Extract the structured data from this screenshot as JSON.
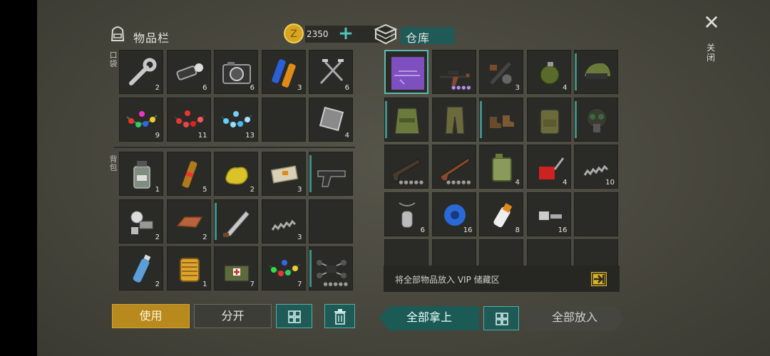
{
  "inventory": {
    "title": "物品栏",
    "coins": "2350",
    "pocket_label": "口袋",
    "backpack_label": "背包",
    "pocket_slots": [
      {
        "icon": "wrench-icon",
        "count": "2"
      },
      {
        "icon": "flashlight-icon",
        "count": "6"
      },
      {
        "icon": "camera-icon",
        "count": "6"
      },
      {
        "icon": "battery-icon",
        "count": "3"
      },
      {
        "icon": "nails-icon",
        "count": "6"
      },
      {
        "icon": "christmas-lights-multicolor-icon",
        "count": "9"
      },
      {
        "icon": "christmas-lights-red-icon",
        "count": "11"
      },
      {
        "icon": "christmas-lights-blue-icon",
        "count": "13"
      },
      {
        "icon": "empty",
        "count": ""
      },
      {
        "icon": "metal-plate-icon",
        "count": "4"
      }
    ],
    "backpack_slots": [
      {
        "icon": "jar-icon",
        "count": "1"
      },
      {
        "icon": "ampoule-icon",
        "count": "5"
      },
      {
        "icon": "gold-nugget-icon",
        "count": "2"
      },
      {
        "icon": "bandage-box-icon",
        "count": "3"
      },
      {
        "icon": "pistol-icon",
        "count": ""
      },
      {
        "icon": "mech-parts-icon",
        "count": "2"
      },
      {
        "icon": "copper-ingot-icon",
        "count": "2"
      },
      {
        "icon": "machete-icon",
        "count": ""
      },
      {
        "icon": "spring-icon",
        "count": "3"
      },
      {
        "icon": "empty",
        "count": ""
      },
      {
        "icon": "water-bottle-icon",
        "count": "2"
      },
      {
        "icon": "filter-icon",
        "count": "1"
      },
      {
        "icon": "medkit-bag-icon",
        "count": "7"
      },
      {
        "icon": "christmas-lights-green-icon",
        "count": "7"
      },
      {
        "icon": "drone-icon",
        "count": ""
      }
    ],
    "buttons": {
      "use": "使用",
      "split": "分开"
    }
  },
  "storage": {
    "title": "仓库",
    "close_label": "关闭",
    "slots": [
      {
        "icon": "weapon-blueprint-icon",
        "count": ""
      },
      {
        "icon": "assault-rifle-icon",
        "count": ""
      },
      {
        "icon": "weapon-parts-icon",
        "count": "3"
      },
      {
        "icon": "grenade-icon",
        "count": "4"
      },
      {
        "icon": "helmet-goggles-icon",
        "count": ""
      },
      {
        "icon": "tactical-vest-icon",
        "count": ""
      },
      {
        "icon": "camo-pants-icon",
        "count": ""
      },
      {
        "icon": "boots-icon",
        "count": ""
      },
      {
        "icon": "backpack-icon",
        "count": ""
      },
      {
        "icon": "gas-mask-icon",
        "count": ""
      },
      {
        "icon": "shotgun-icon",
        "count": ""
      },
      {
        "icon": "hunting-rifle-icon",
        "count": ""
      },
      {
        "icon": "jerry-can-icon",
        "count": "4"
      },
      {
        "icon": "oil-can-icon",
        "count": "4"
      },
      {
        "icon": "spring-icon",
        "count": "10"
      },
      {
        "icon": "dog-tags-icon",
        "count": "6"
      },
      {
        "icon": "duct-tape-icon",
        "count": "16"
      },
      {
        "icon": "glue-icon",
        "count": "8"
      },
      {
        "icon": "bolt-nut-icon",
        "count": "16"
      },
      {
        "icon": "empty",
        "count": ""
      }
    ],
    "vip_text": "将全部物品放入 VIP 储藏区",
    "buttons": {
      "take_all": "全部拿上",
      "put_all": "全部放入"
    }
  },
  "colors": {
    "accent": "#4fb0a8",
    "gold": "#b8891c",
    "slot": "#2a2b27"
  }
}
